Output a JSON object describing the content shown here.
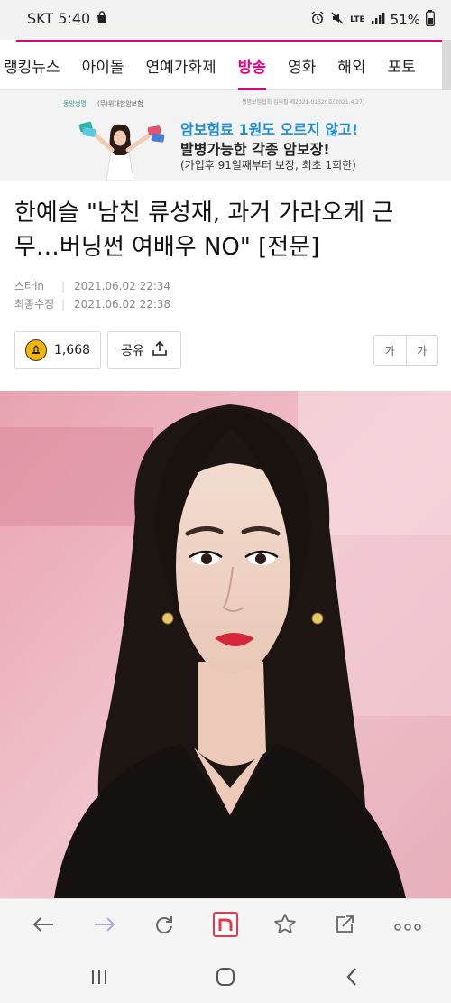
{
  "status_bar": {
    "carrier_time": "SKT 5:40",
    "network": "LTE",
    "battery": "51%"
  },
  "nav": {
    "items": [
      "랭킹뉴스",
      "아이돌",
      "연예가화제",
      "방송",
      "영화",
      "해외",
      "포토"
    ],
    "active": "방송"
  },
  "ad": {
    "logo_text": "동양생명",
    "org": "(무)위대한암보험",
    "legal": "생명보험협회 심의필 제2021-01320호(2021.4.27)",
    "line1": "암보험료 1원도 오르지 않고!",
    "line2": "발병가능한 각종 암보장!",
    "line3": "(가입후 91일째부터 보장, 최초 1회한)"
  },
  "article": {
    "headline": "한예슬 \"남친 류성재, 과거 가라오케 근무…버닝썬 여배우 NO\" [전문]",
    "source": "스타in",
    "published": "2021.06.02 22:34",
    "modified_label": "최종수정",
    "modified": "2021.06.02 22:38",
    "like_count": "1,668",
    "share_label": "공유",
    "font_small": "가",
    "font_large": "가"
  },
  "colors": {
    "accent": "#e6007e",
    "like_icon": "#f2b705"
  },
  "toolbar": {
    "icons": [
      "back-icon",
      "forward-icon",
      "refresh-icon",
      "naver-n-icon",
      "bookmark-star-icon",
      "share-icon",
      "more-icon"
    ]
  }
}
